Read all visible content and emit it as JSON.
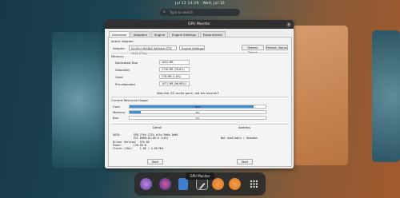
{
  "topbar": {
    "clock": "Jul 12 14:29  ·  Wed, Jul 10"
  },
  "search": {
    "placeholder": "Type to search"
  },
  "window": {
    "title": "GPU Monitor",
    "tabs": [
      "Overview",
      "Adapters",
      "Engine",
      "Engine Settings",
      "Experiments"
    ],
    "section_adapter": "Active Adapter",
    "adapter_label": "Adapter",
    "adapter_value": "00:02.0 NVIDIA GeForce GTX 1060 (PCIe)",
    "settings_label": "Engine Settings",
    "btn_refresh_device": "Refresh Device",
    "btn_refresh_all": "Refresh Status",
    "section_metrics": "Memory",
    "metrics": [
      {
        "label": "Dedicated Size",
        "value": "1024 MB"
      },
      {
        "label": "Allocated",
        "value": "1736 MB (76.6%)"
      },
      {
        "label": "Used",
        "value": "576 MB (1.8%)"
      },
      {
        "label": "Pre-allocated",
        "value": "1871 MB (96.98%)"
      }
    ],
    "question": "Was the OS cache gone, did we recover?",
    "section_usage": "Current Resource Usage",
    "usage": [
      {
        "label": "Core",
        "pct_text": "91%",
        "fraction": 0.91
      },
      {
        "label": "Memory",
        "pct_text": "8%",
        "fraction": 0.08
      },
      {
        "label": "Bus",
        "pct_text": "0%",
        "fraction": 0.0
      }
    ],
    "col_left": "Detail",
    "col_right": "Address",
    "info_left": "UUID:        GPU-7f0c-1224-4f1d-9b6a-3dd9\n             PCI 0000:01:00.0 (x16)\nDriver Version:  535.86\nPower:       120.00 W\nClocks (GHz):    1.86 / 4.00 MHz",
    "info_right": "Not Available / Unknown",
    "btn_left": "Start",
    "btn_right": "Start"
  },
  "dock": {
    "tooltip": "GPU Monitor",
    "apps": [
      {
        "name": "shell"
      },
      {
        "name": "media"
      },
      {
        "name": "docs"
      },
      {
        "name": "gpu-tool"
      },
      {
        "name": "settings"
      },
      {
        "name": "app-grid"
      }
    ]
  }
}
